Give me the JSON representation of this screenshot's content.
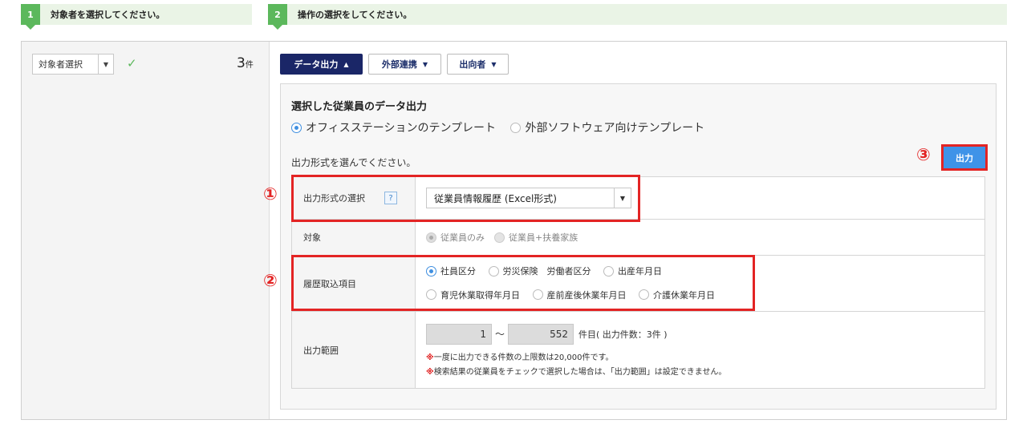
{
  "steps": [
    {
      "num": "1",
      "label": "対象者を選択してください。"
    },
    {
      "num": "2",
      "label": "操作の選択をしてください。"
    }
  ],
  "target": {
    "select_label": "対象者選択",
    "count_value": "3",
    "count_unit": "件"
  },
  "tabs": [
    {
      "label": "データ出力",
      "caret": "▲"
    },
    {
      "label": "外部連携",
      "caret": "▼"
    },
    {
      "label": "出向者",
      "caret": "▼"
    }
  ],
  "panel": {
    "title": "選択した従業員のデータ出力",
    "template_options": [
      "オフィスステーションのテンプレート",
      "外部ソフトウェア向けテンプレート"
    ],
    "instruction": "出力形式を選んでください。",
    "output_button": "出力"
  },
  "table": {
    "format_label": "出力形式の選択",
    "help_glyph": "?",
    "format_value": "従業員情報履歴 (Excel形式)",
    "target_label": "対象",
    "target_options": [
      "従業員のみ",
      "従業員+扶養家族"
    ],
    "history_label": "履歴取込項目",
    "history_row1": [
      "社員区分",
      "労災保険　労働者区分",
      "出産年月日"
    ],
    "history_row2": [
      "育児休業取得年月日",
      "産前産後休業年月日",
      "介護休業年月日"
    ],
    "range_label": "出力範囲",
    "range_from": "1",
    "range_sep": "～",
    "range_to": "552",
    "range_info": "件目( 出力件数：3件 )",
    "note_mark": "※",
    "note1": "一度に出力できる件数の上限数は20,000件です。",
    "note2": "検索結果の従業員をチェックで選択した場合は、「出力範囲」は設定できません。"
  },
  "annotations": [
    "①",
    "②",
    "③"
  ],
  "colors": {
    "accent_green": "#5cb85c",
    "navy": "#1a2667",
    "blue_button": "#3f93e8",
    "annotation_red": "#e32424"
  }
}
